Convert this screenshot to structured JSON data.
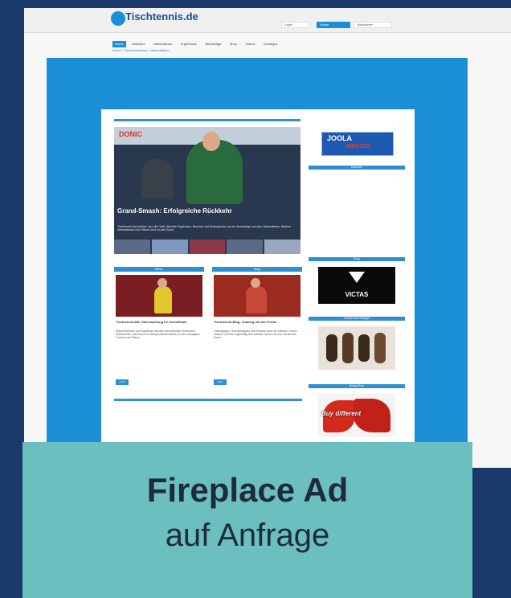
{
  "site": {
    "logo_text": "Tischtennis.de",
    "top_nav": [
      "Login",
      "Suche",
      "Abonnieren"
    ],
    "menu": [
      "Home",
      "Aktuelles",
      "Nationalteam",
      "Ergebnisse",
      "Bundesliga",
      "Shop",
      "Videos",
      "Sonstiges"
    ],
    "breadcrumb": "Home › Tischtennisnews › Nationalteam"
  },
  "hero": {
    "banner_brand": "DONIC",
    "title": "Grand-Smash: Erfolgreiche Rückkehr",
    "text": "Tischtennis Nachrichten aus aller Welt. Aktuelle Ergebnisse, Berichte und Hintergründe aus der Bundesliga und dem Nationalteam. Weitere Informationen und Videos rund um den Sport."
  },
  "columns": [
    {
      "head": "News",
      "title": "Tischtennis-EM: Überraschung im Viertelfinale",
      "text": "Aktuelle Berichte und Ergebnisse aus dem internationalen Tischtennis. Spielberichte, Interviews und Hintergrundinformationen zu den wichtigsten Turnieren der Saison.",
      "more": "mehr"
    },
    {
      "head": "Blog",
      "title": "Tischtennis-Blog: Training mit den Profis",
      "text": "Trainingstipps, Technikanalysen und Einblicke hinter die Kulissen. Unsere Autoren berichten regelmäßig über aktuelle Themen aus der Tischtennis-Szene.",
      "more": "mehr"
    }
  ],
  "sidebar": {
    "ad1": "JOOLA",
    "ad1_sub": "WINSTER",
    "boxes": [
      "Kalender",
      "Shop",
      "Tischtennis-Schläger",
      "Belag-Shop",
      "Videos"
    ],
    "victas": "VICTAS",
    "buy_label": "Buy different"
  },
  "overlay": {
    "title": "Fireplace Ad",
    "subtitle": "auf Anfrage"
  }
}
